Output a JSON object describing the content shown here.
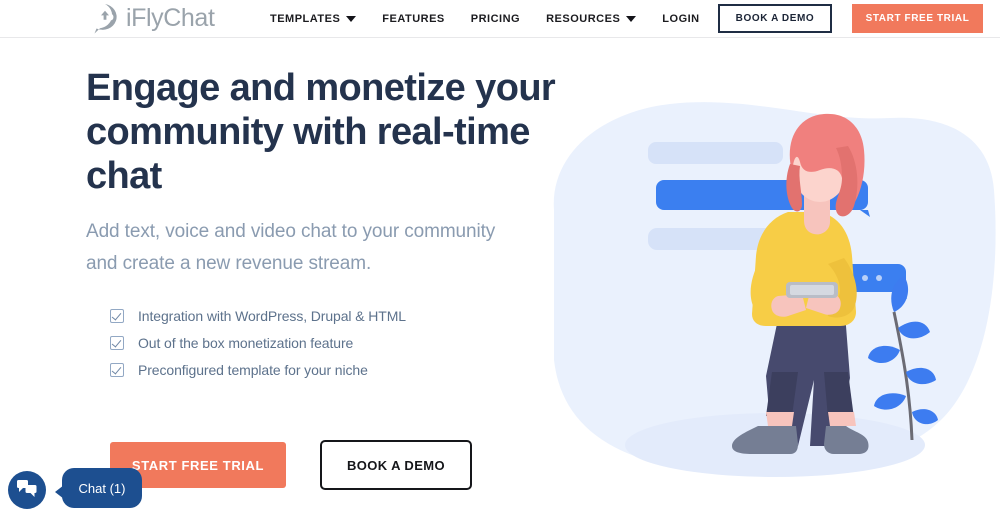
{
  "header": {
    "logo": {
      "icon": "cloud-upload-speech-bubble-icon",
      "text_prefix": "i",
      "text": "iFlyChat"
    },
    "nav": [
      {
        "label": "TEMPLATES",
        "has_dropdown": true
      },
      {
        "label": "FEATURES",
        "has_dropdown": false
      },
      {
        "label": "PRICING",
        "has_dropdown": false
      },
      {
        "label": "RESOURCES",
        "has_dropdown": true
      },
      {
        "label": "LOGIN",
        "has_dropdown": false
      }
    ],
    "book_demo_label": "BOOK A DEMO",
    "start_trial_label": "START FREE TRIAL"
  },
  "hero": {
    "headline": "Engage and monetize your community with real-time chat",
    "subhead": "Add text, voice and video chat to your community and create a new revenue stream.",
    "checklist": [
      "Integration with WordPress, Drupal & HTML",
      "Out of the box monetization feature",
      "Preconfigured template for your niche"
    ],
    "start_trial_label": "START FREE TRIAL",
    "book_demo_label": "BOOK A DEMO"
  },
  "chat_widget": {
    "label": "Chat (1)",
    "unread_count": 1,
    "icon": "chat-bubbles-icon"
  },
  "colors": {
    "accent_orange": "#f1795c",
    "headline_navy": "#24334d",
    "subhead_gray": "#8a9bb0",
    "chat_blue": "#1d4f90",
    "illustration_blue": "#3b7ff0",
    "illustration_bg": "#eaf1fd",
    "logo_gray": "#9aa3ab",
    "sweater_yellow": "#f7cd46",
    "hair_coral": "#f0807e",
    "pants_navy": "#474a6e"
  }
}
